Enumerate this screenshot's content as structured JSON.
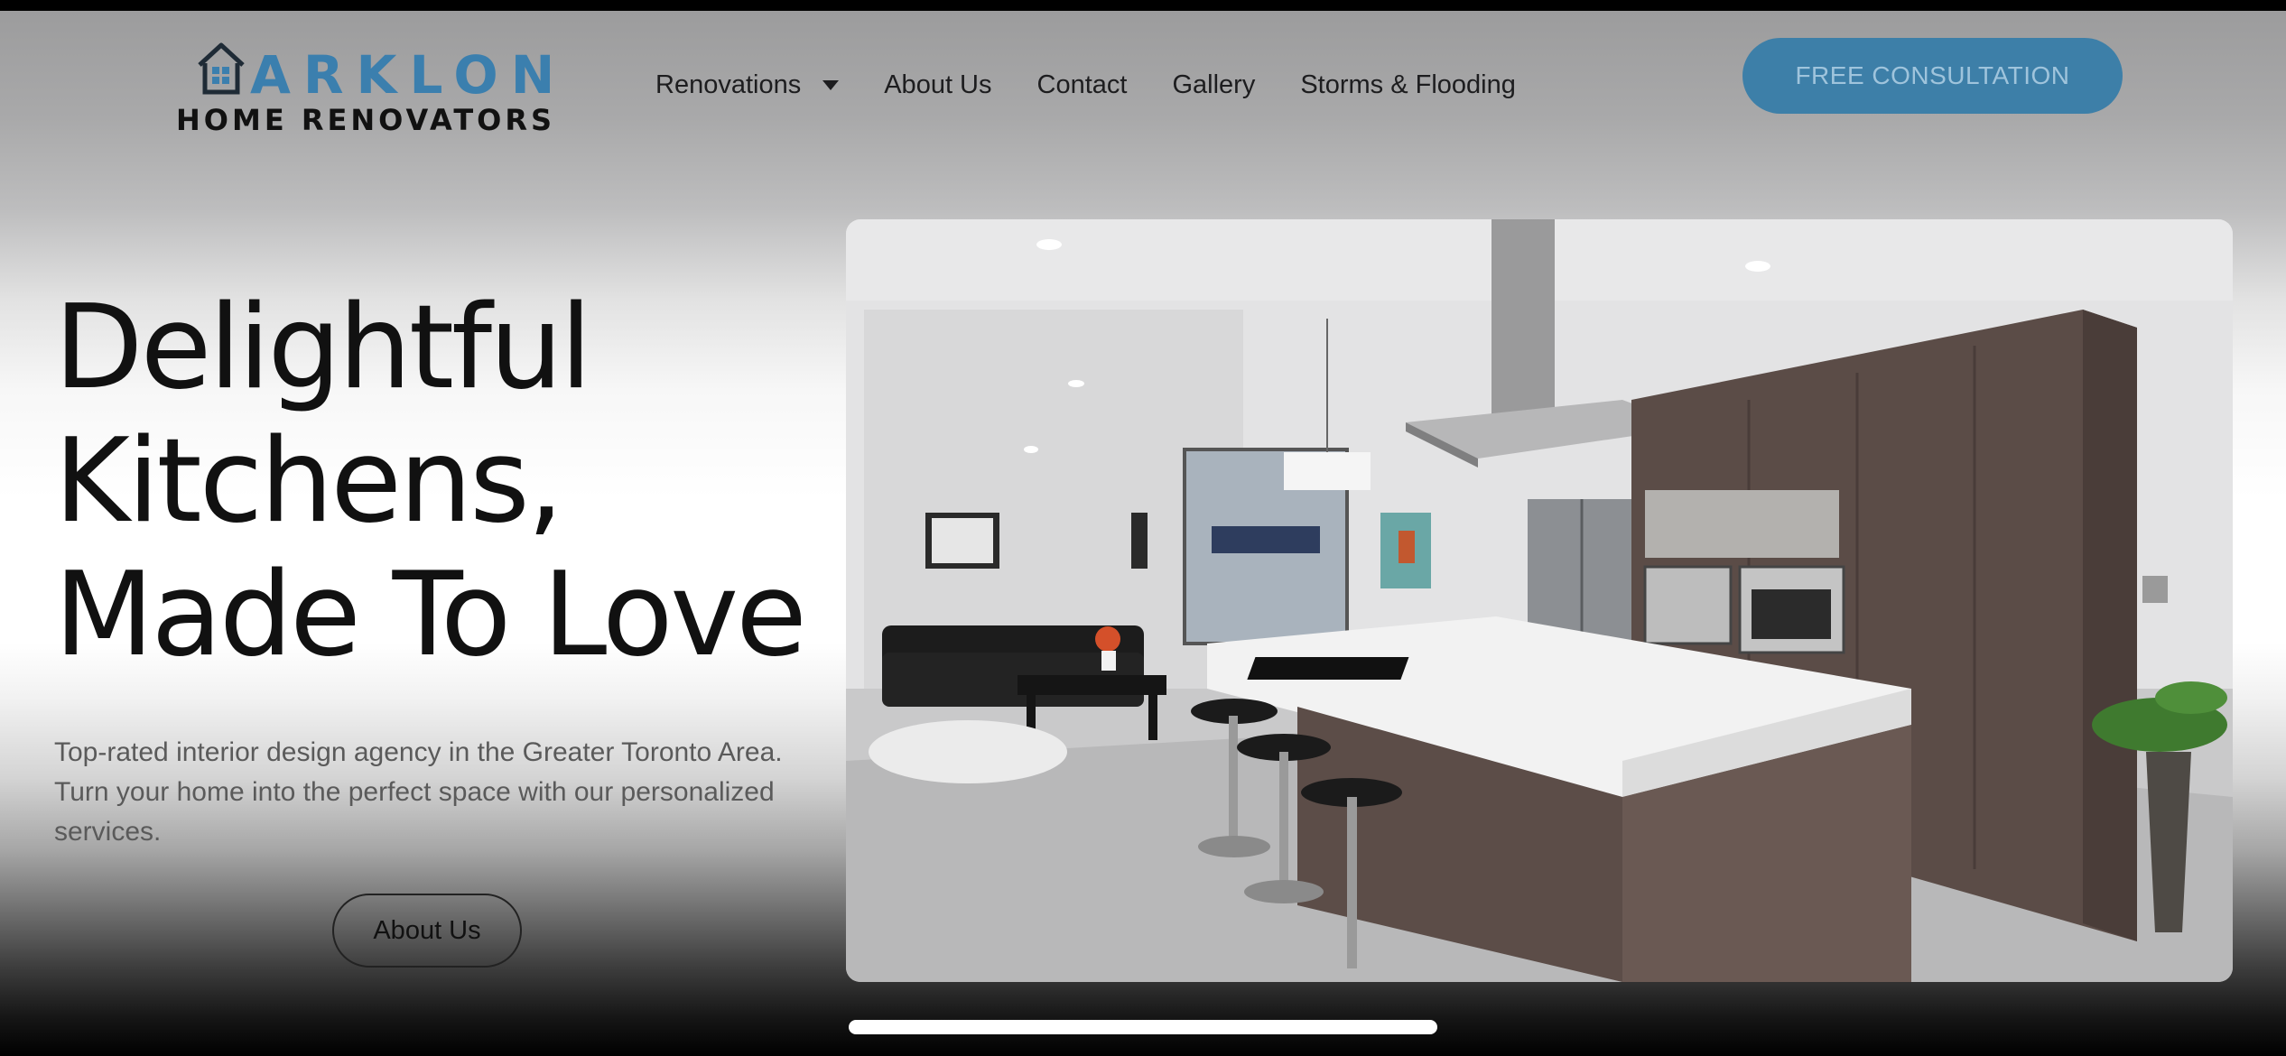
{
  "brand": {
    "name": "ARKLON",
    "tagline": "HOME RENOVATORS",
    "logo_icon": "house-icon",
    "color": "#3b7fae"
  },
  "nav": {
    "items": [
      {
        "label": "Renovations",
        "has_dropdown": true
      },
      {
        "label": "About Us"
      },
      {
        "label": "Contact"
      },
      {
        "label": "Gallery"
      },
      {
        "label": "Storms & Flooding"
      }
    ],
    "dropdown_icon": "caret-down-icon"
  },
  "cta": {
    "label": "FREE CONSULTATION",
    "color": "#3d7fa8"
  },
  "hero": {
    "headline": [
      "Delightful",
      "Kitchens,",
      "Made To Love"
    ],
    "subtext": "Top-rated interior design agency in the Greater Toronto Area. Turn your home into the perfect space with our personalized services.",
    "button_label": "About Us",
    "image": "modern-kitchen-photo"
  }
}
